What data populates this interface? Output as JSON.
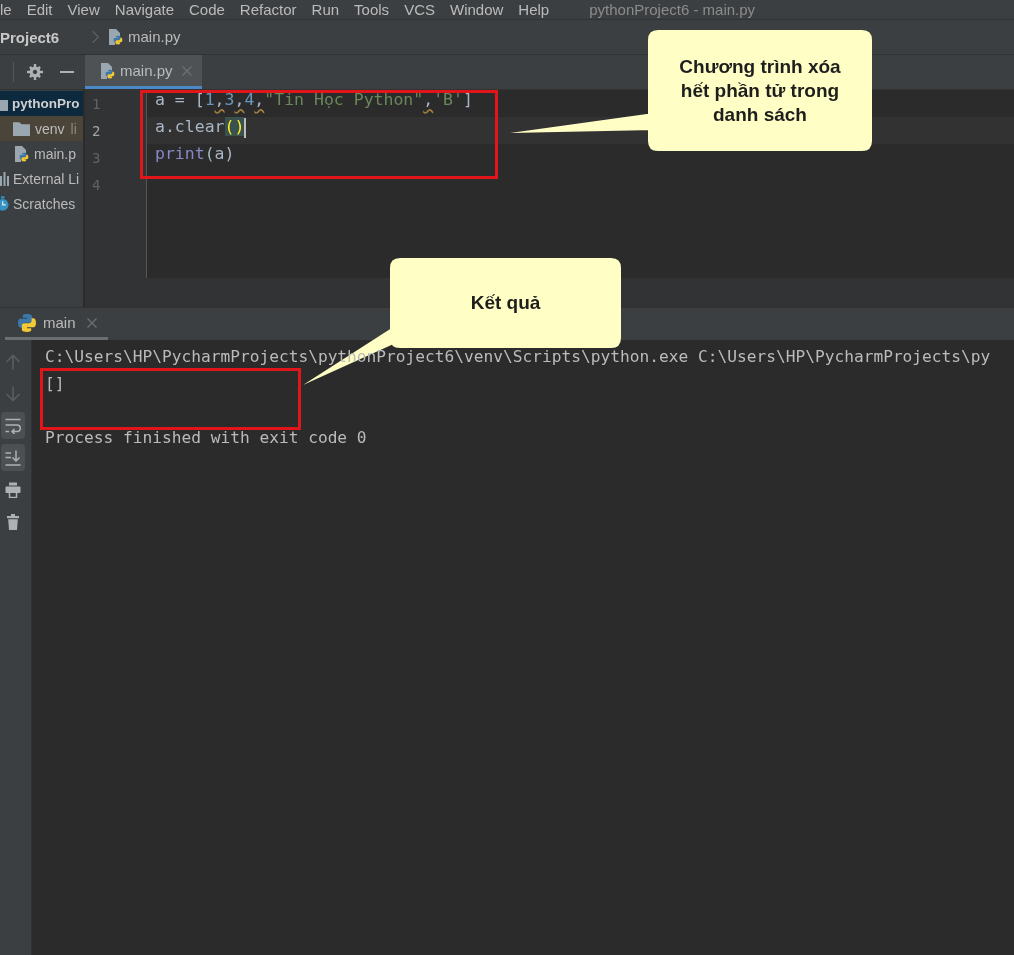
{
  "menu_bar": {
    "items": [
      "le",
      "Edit",
      "View",
      "Navigate",
      "Code",
      "Refactor",
      "Run",
      "Tools",
      "VCS",
      "Window",
      "Help"
    ],
    "title": "pythonProject6 - main.py"
  },
  "breadcrumb": [
    {
      "label": "Project6",
      "kind": "project"
    },
    {
      "label": "main.py",
      "kind": "file"
    }
  ],
  "editor_tabs": [
    {
      "label": "main.py",
      "selected": true
    }
  ],
  "project_tree": [
    {
      "label": "pythonPro",
      "kind": "project",
      "selected": true,
      "children": [
        {
          "label": "venv",
          "note": "li",
          "kind": "excluded-folder",
          "selected": false
        },
        {
          "label": "main.p",
          "kind": "file",
          "selected": false
        }
      ]
    },
    {
      "label": "External Li",
      "kind": "libraries",
      "selected": false
    },
    {
      "label": "Scratches",
      "kind": "scratches",
      "selected": false
    }
  ],
  "editor": {
    "lines": [
      {
        "number": "1",
        "current": false,
        "caret": false,
        "tokens": [
          {
            "text": "a = [",
            "kind": "plain"
          },
          {
            "text": "1",
            "kind": "number"
          },
          {
            "text": ",",
            "kind": "warning"
          },
          {
            "text": "3",
            "kind": "number"
          },
          {
            "text": ",",
            "kind": "warning"
          },
          {
            "text": "4",
            "kind": "number"
          },
          {
            "text": ",",
            "kind": "warning"
          },
          {
            "text": "\"Tin Học Python\"",
            "kind": "string"
          },
          {
            "text": ",",
            "kind": "warning"
          },
          {
            "text": "'B'",
            "kind": "string"
          },
          {
            "text": "]",
            "kind": "plain"
          }
        ]
      },
      {
        "number": "2",
        "current": true,
        "caret": true,
        "tokens": [
          {
            "text": "a.clear",
            "kind": "plain"
          },
          {
            "text": "()",
            "kind": "brace-match"
          }
        ]
      },
      {
        "number": "3",
        "current": false,
        "caret": false,
        "tokens": [
          {
            "text": "print",
            "kind": "builtin"
          },
          {
            "text": "(a)",
            "kind": "plain"
          }
        ]
      },
      {
        "number": "4",
        "current": false,
        "caret": false
      }
    ]
  },
  "run_panel": {
    "tabs": [
      {
        "label": "main",
        "selected": true
      }
    ],
    "toolbar": [
      {
        "kind": "up",
        "disabled": true,
        "on": false
      },
      {
        "kind": "down",
        "disabled": true,
        "on": false
      },
      {
        "kind": "soft-wrap",
        "disabled": false,
        "on": true
      },
      {
        "kind": "scroll-to-end",
        "disabled": false,
        "on": true
      },
      {
        "kind": "print",
        "disabled": false,
        "on": false
      },
      {
        "kind": "clear",
        "disabled": false,
        "on": false
      }
    ],
    "output": [
      {
        "text": "C:\\Users\\HP\\PycharmProjects\\pythonProject6\\venv\\Scripts\\python.exe C:\\Users\\HP\\PycharmProjects\\py",
        "kind": "command"
      },
      {
        "text": "[]",
        "kind": "stdout"
      },
      {
        "text": "Process finished with exit code 0",
        "kind": "exit"
      }
    ]
  },
  "callouts": [
    {
      "text": "Chương trình xóa hết phần tử trong danh sách"
    },
    {
      "text": "Kết quả"
    }
  ]
}
